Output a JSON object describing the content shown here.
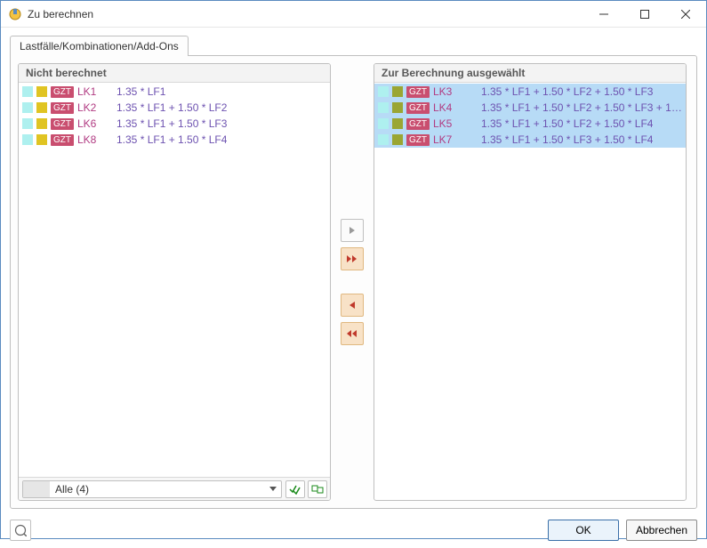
{
  "window": {
    "title": "Zu berechnen",
    "tab": "Lastfälle/Kombinationen/Add-Ons"
  },
  "left": {
    "header": "Nicht berechnet",
    "items": [
      {
        "badge": "GZT",
        "lk": "LK1",
        "formula": "1.35 * LF1"
      },
      {
        "badge": "GZT",
        "lk": "LK2",
        "formula": "1.35 * LF1 + 1.50 * LF2"
      },
      {
        "badge": "GZT",
        "lk": "LK6",
        "formula": "1.35 * LF1 + 1.50 * LF3"
      },
      {
        "badge": "GZT",
        "lk": "LK8",
        "formula": "1.35 * LF1 + 1.50 * LF4"
      }
    ],
    "filter": "Alle (4)"
  },
  "right": {
    "header": "Zur Berechnung ausgewählt",
    "items": [
      {
        "badge": "GZT",
        "lk": "LK3",
        "formula": "1.35 * LF1 + 1.50 * LF2 + 1.50 * LF3"
      },
      {
        "badge": "GZT",
        "lk": "LK4",
        "formula": "1.35 * LF1 + 1.50 * LF2 + 1.50 * LF3 + 1.50 ..."
      },
      {
        "badge": "GZT",
        "lk": "LK5",
        "formula": "1.35 * LF1 + 1.50 * LF2 + 1.50 * LF4"
      },
      {
        "badge": "GZT",
        "lk": "LK7",
        "formula": "1.35 * LF1 + 1.50 * LF3 + 1.50 * LF4"
      }
    ]
  },
  "buttons": {
    "ok": "OK",
    "cancel": "Abbrechen"
  },
  "icons": {
    "move_right": "►",
    "move_all_right": "►►",
    "move_left": "◄",
    "move_all_left": "◄◄"
  }
}
